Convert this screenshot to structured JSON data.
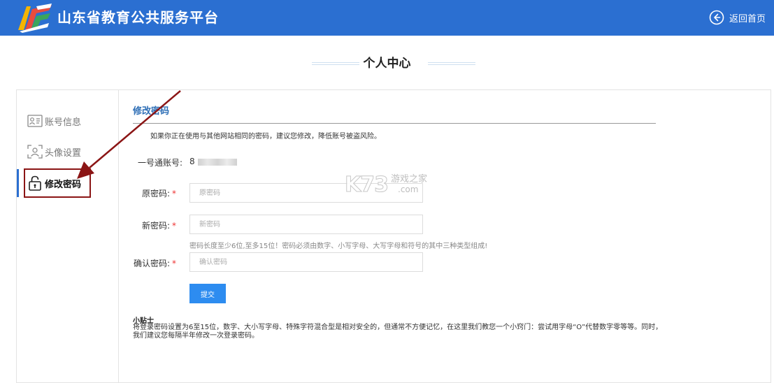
{
  "header": {
    "site_title": "山东省教育公共服务平台",
    "back_home": "返回首页",
    "logo_icon": "platform-logo-icon",
    "back_icon": "back-arrow-circle-icon",
    "bg_color": "#2b6fd1"
  },
  "page": {
    "title": "个人中心"
  },
  "sidebar": {
    "items": [
      {
        "label": "账号信息",
        "icon": "id-card-icon",
        "active": false
      },
      {
        "label": "头像设置",
        "icon": "avatar-frame-icon",
        "active": false
      },
      {
        "label": "修改密码",
        "icon": "lock-icon",
        "active": true
      }
    ]
  },
  "form": {
    "section_title": "修改密码",
    "notice": "如果你正在使用与其他网站相同的密码，建议您修改，降低账号被盗风险。",
    "account_label": "一号通账号:",
    "account_value": "8",
    "old_password": {
      "label": "原密码:",
      "required": "*",
      "placeholder": "原密码"
    },
    "new_password": {
      "label": "新密码:",
      "required": "*",
      "placeholder": "新密码"
    },
    "password_hint": "密码长度至少6位,至多15位！密码必须由数字、小写字母、大写字母和符号的其中三种类型组成!",
    "confirm_password": {
      "label": "确认密码:",
      "required": "*",
      "placeholder": "确认密码"
    },
    "submit_label": "提交"
  },
  "tips": {
    "title": "小贴士",
    "text": "将登录密码设置为6至15位，数字、大小写字母、特殊字符混合型是相对安全的，但通常不方便记忆，在这里我们教您一个小窍门：尝试用字母“O”代替数字零等等。同时，我们建议您每隔半年修改一次登录密码。"
  },
  "watermark": {
    "big": "K73",
    "small": "游戏之家",
    "com": ".com"
  },
  "colors": {
    "accent": "#2d8cf0",
    "highlight": "#8b1515",
    "section_title": "#2f6fb6"
  }
}
